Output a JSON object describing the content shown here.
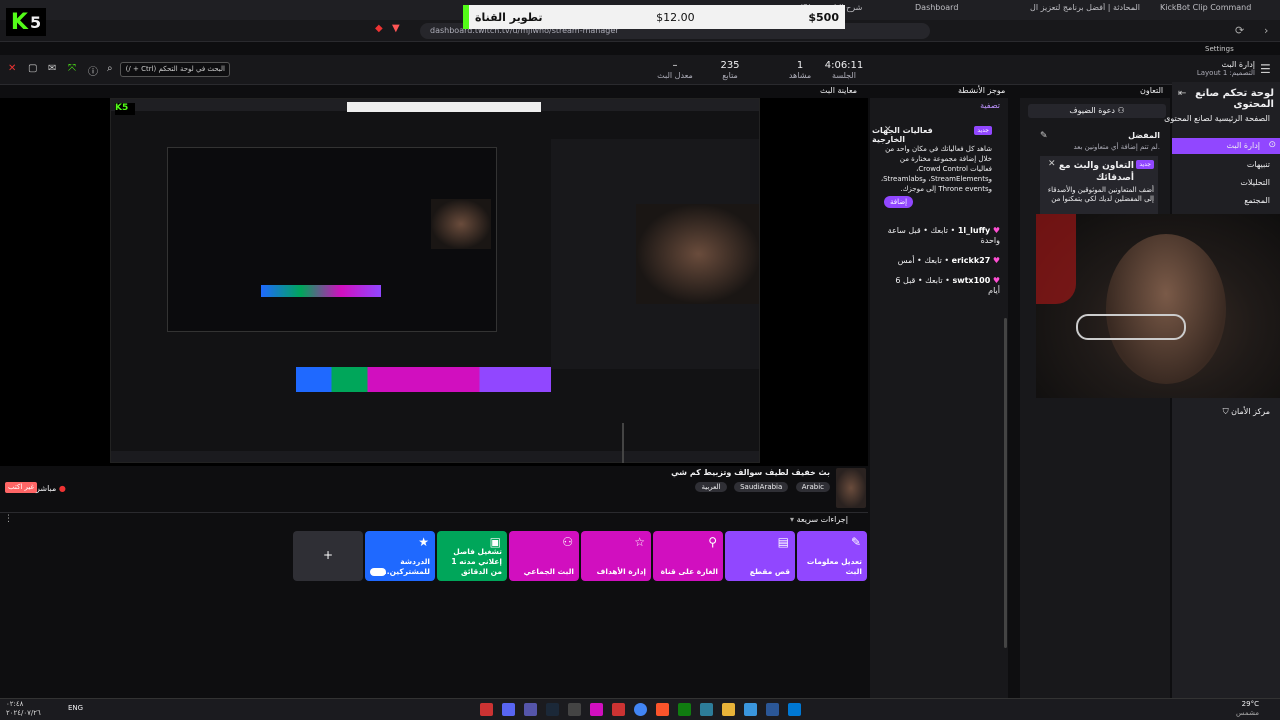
{
  "browser": {
    "tabs": [
      "(2) شرح الثابت بم",
      "Dashboard",
      "روبوت المحادثة | أفضل برنامج لتعزيز ال",
      "KickBot Clip Command"
    ],
    "url": "dashboard.twitch.tv/u/mjlwho/stream-manager"
  },
  "overlay": {
    "title": "تطوير القناة",
    "current": "$12.00",
    "goal": "$500"
  },
  "logo": {
    "letter": "K",
    "number": "5"
  },
  "header": {
    "search_placeholder": "البحث في لوحة التحكم (Ctrl + /)",
    "stats": [
      {
        "value": "4:06:11",
        "label": "الجلسة"
      },
      {
        "value": "1",
        "label": "مشاهد"
      },
      {
        "value": "235",
        "label": "متابع"
      },
      {
        "value": "–",
        "label": "معدل البث"
      }
    ],
    "layout_title": "إدارة البث",
    "layout_sub": "التصميم: Layout 1",
    "settings": "Settings"
  },
  "panels": {
    "preview": "معاينة البث",
    "activity": "موجز الأنشطة",
    "collab": "التعاون"
  },
  "nav": {
    "title": "لوحة تحكم صانع المحتوى",
    "items": [
      {
        "label": "الصفحة الرئيسية لصانع المحتوى",
        "icon": "home-icon"
      },
      {
        "label": "إدارة البث",
        "icon": "broadcast-icon",
        "active": true
      },
      {
        "label": "تنبيهات",
        "icon": "megaphone-icon"
      },
      {
        "label": "التحليلات",
        "icon": "analytics-icon"
      },
      {
        "label": "المجتمع",
        "icon": "community-icon"
      }
    ],
    "safety": "مركز الأمان"
  },
  "collab": {
    "invite": "دعوة الضيوف",
    "favorites_title": "المفضل",
    "favorites_text": "لم تتم إضافة أي متعاونين بعد.",
    "promo_badge": "جديد",
    "promo_title": "التعاون والبث مع أصدقائك",
    "promo_text": "أضف المتعاونين الموثوقين والأصدقاء إلى المفضلين لديك لكي يتمكنوا من"
  },
  "activity": {
    "filter": "تصفية",
    "card_badge": "جديد",
    "card_title": "فعاليات الجهات الخارجية",
    "card_text": "شاهد كل فعالياتك في مكان واحد من خلال إضافة مجموعة مختارة من فعاليات Crowd Control، وStreamElements، وStreamlabs، وThrone events إلى موجزك.",
    "card_button": "إضافة",
    "events": [
      {
        "user": "1l_luffy",
        "action": "تابعك",
        "time": "قبل ساعة واحدة"
      },
      {
        "user": "erickk27",
        "action": "تابعك",
        "time": "أمس"
      },
      {
        "user": "swtx100",
        "action": "تابعك",
        "time": "قبل 6 أيام"
      }
    ]
  },
  "stream": {
    "title": "بث خفيف لطيف سوالف وتزبيط كم شي",
    "tags": [
      "Arabic",
      "SaudiArabia",
      "العربية"
    ],
    "live_label": "مباشر",
    "offline_button": "غير اكتب"
  },
  "quick_actions": {
    "title": "إجراءات سريعة",
    "add": "+",
    "items": [
      {
        "label": "تعديل معلومات البث",
        "icon": "pencil-icon",
        "color": "#9147ff"
      },
      {
        "label": "قص مقطع",
        "icon": "clapper-icon",
        "color": "#9147ff"
      },
      {
        "label": "الغارة على قناة",
        "icon": "raid-icon",
        "color": "#d10fbf"
      },
      {
        "label": "إدارة الأهداف",
        "icon": "star-icon",
        "color": "#d10fbf"
      },
      {
        "label": "البث الجماعي",
        "icon": "add-user-icon",
        "color": "#d10fbf"
      },
      {
        "label": "تشغيل فاصل إعلاني مدته 1 من الدقائق",
        "icon": "ad-icon",
        "color": "#00a65a"
      },
      {
        "label": "الدردشة للمشتركين...",
        "icon": "star-icon",
        "color": "#1f69ff"
      }
    ]
  },
  "taskbar": {
    "time": "٠٢:٤٨",
    "date": "٢٠٢٤/٠٧/٢٦",
    "lang": "ENG",
    "weather": "29°C",
    "weather_label": "مشمس"
  }
}
